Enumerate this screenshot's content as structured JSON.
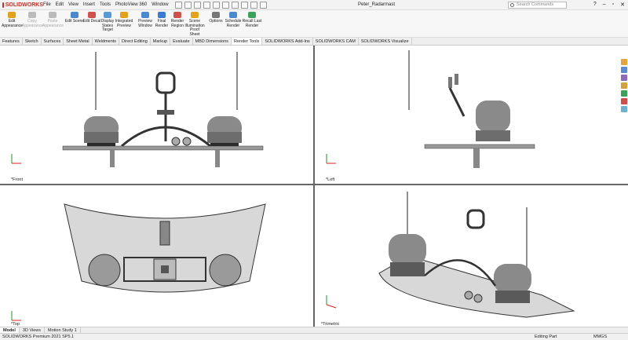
{
  "app": {
    "logo": "SOLIDWORKS",
    "menu": [
      "File",
      "Edit",
      "View",
      "Insert",
      "Tools",
      "PhotoView 360",
      "Window"
    ],
    "doc_title": "Peter_Radarmast",
    "search_placeholder": "Search Commands"
  },
  "ribbon": {
    "buttons": [
      {
        "label": "Edit Appearance",
        "dim": false
      },
      {
        "label": "Copy Appearance",
        "dim": true
      },
      {
        "label": "Paste Appearance",
        "dim": true
      },
      {
        "label": "Edit Scene",
        "dim": false
      },
      {
        "label": "Edit Decal",
        "dim": false
      },
      {
        "label": "Display States Target",
        "dim": false
      },
      {
        "label": "Integrated Preview",
        "dim": false
      },
      {
        "label": "Preview Window",
        "dim": false
      },
      {
        "label": "Final Render",
        "dim": false
      },
      {
        "label": "Render Region",
        "dim": false
      },
      {
        "label": "Scene Illumination Proof Sheet",
        "dim": false
      },
      {
        "label": "Options",
        "dim": false
      },
      {
        "label": "Schedule Render",
        "dim": false
      },
      {
        "label": "Recall Last Render",
        "dim": false
      }
    ]
  },
  "tabs": [
    "Features",
    "Sketch",
    "Surfaces",
    "Sheet Metal",
    "Weldments",
    "Direct Editing",
    "Markup",
    "Evaluate",
    "MBD Dimensions",
    "Render Tools",
    "SOLIDWORKS Add-Ins",
    "SOLIDWORKS CAM",
    "SOLIDWORKS Visualize"
  ],
  "active_tab": "Render Tools",
  "viewports": {
    "front": "*Front",
    "left": "*Left",
    "top": "*Top",
    "trimetric": "*Trimetric"
  },
  "bottom_tabs": [
    "Model",
    "3D Views",
    "Motion Study 1"
  ],
  "status": {
    "version": "SOLIDWORKS Premium 2021 SP5.1",
    "mode": "Editing Part",
    "units": "MMGS"
  }
}
